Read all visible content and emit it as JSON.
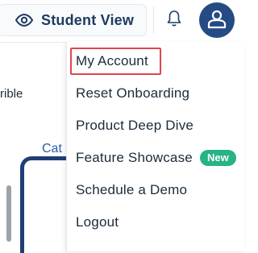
{
  "header": {
    "student_view_label": "Student View",
    "icons": {
      "view": "eye-icon",
      "notifications": "bell-icon",
      "account": "user-avatar-icon"
    },
    "colors": {
      "brand": "#254b84",
      "button_text": "#1f3a60"
    }
  },
  "background": {
    "partial_text": "rible",
    "tab_partial": "Cat"
  },
  "menu": {
    "items": [
      {
        "label": "My Account",
        "highlighted": true
      },
      {
        "label": "Reset Onboarding"
      },
      {
        "label": "Product Deep Dive"
      },
      {
        "label": "Feature Showcase",
        "badge": "New"
      },
      {
        "label": "Schedule a Demo"
      },
      {
        "label": "Logout"
      }
    ],
    "colors": {
      "highlight_border": "#e0464d",
      "badge_bg": "#27b387"
    }
  }
}
